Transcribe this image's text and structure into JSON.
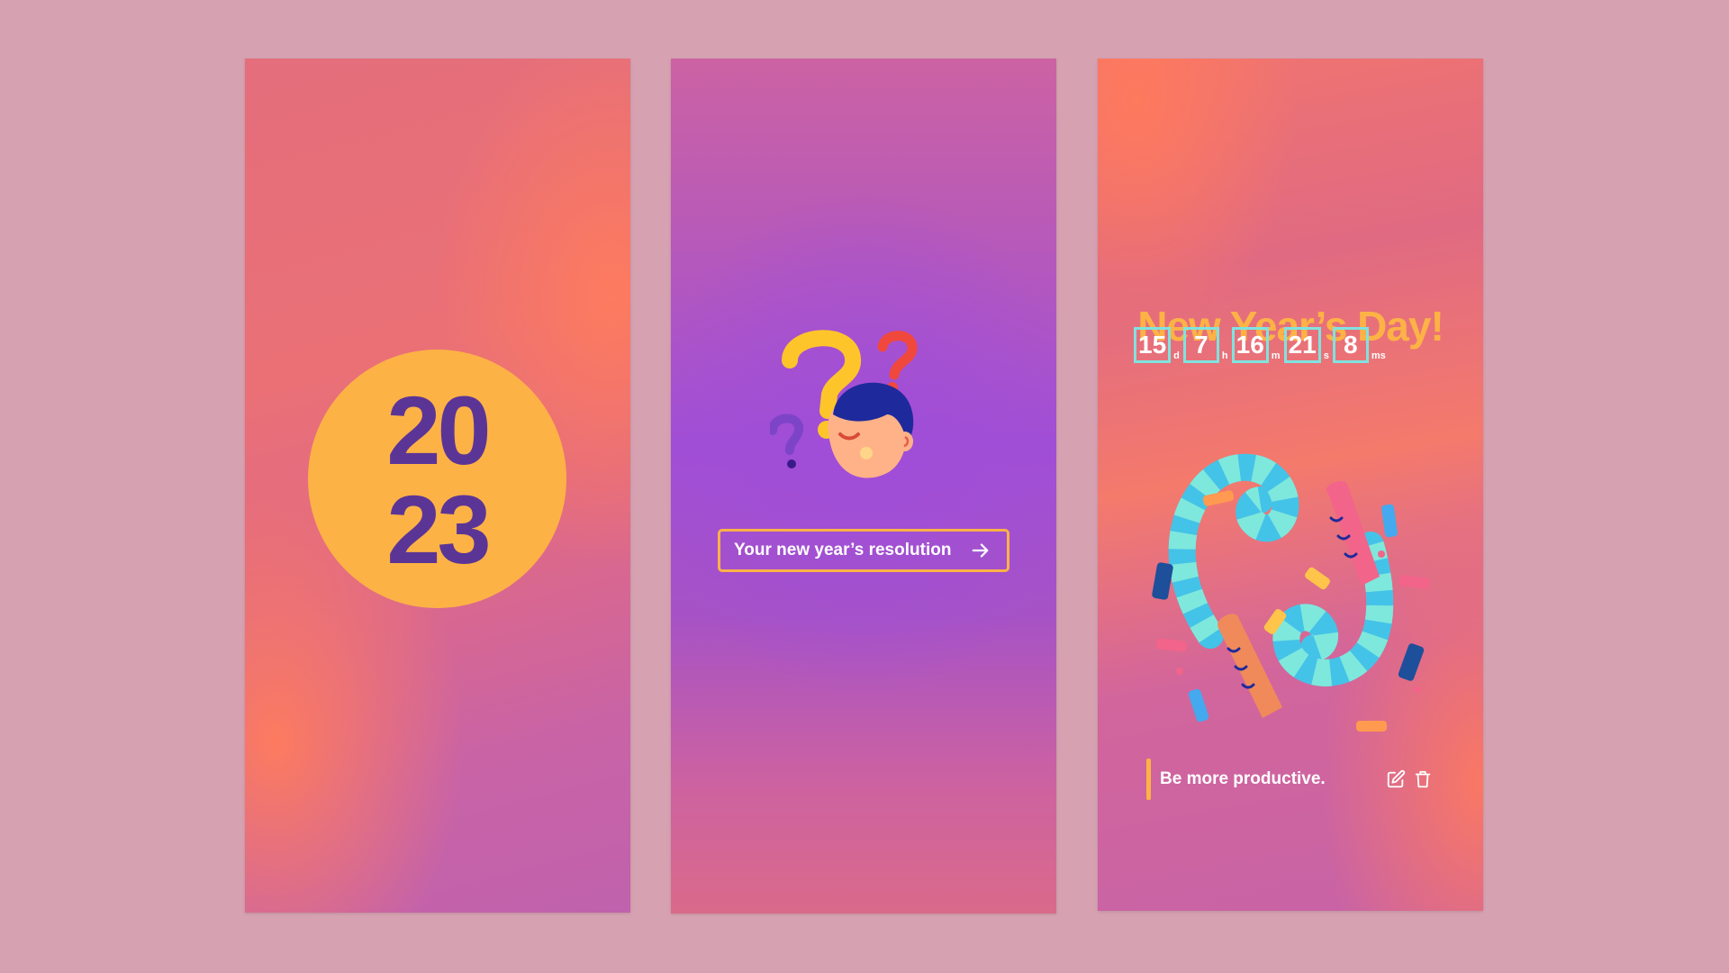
{
  "screen1": {
    "year_top": "20",
    "year_bottom": "23",
    "badge_color": "#fdb246",
    "text_color": "#5b3596"
  },
  "screen2": {
    "illustration": "confused-person-with-question-marks",
    "resolution_button_label": "Your new year’s resolution",
    "arrow_icon": "arrow-right-icon"
  },
  "screen3": {
    "title": "New Year’s Day!",
    "countdown": [
      {
        "value": "15",
        "unit": "d"
      },
      {
        "value": "7",
        "unit": "h"
      },
      {
        "value": "16",
        "unit": "m"
      },
      {
        "value": "21",
        "unit": "s"
      },
      {
        "value": "8",
        "unit": "ms"
      }
    ],
    "illustration": "party-streamers-and-confetti",
    "resolution_text": "Be more productive.",
    "edit_icon": "edit-icon",
    "delete_icon": "trash-icon"
  },
  "colors": {
    "page_background": "#d6a1b1",
    "accent_yellow": "#fdb246",
    "countdown_border": "#7fe3df",
    "purple": "#5b3596"
  }
}
